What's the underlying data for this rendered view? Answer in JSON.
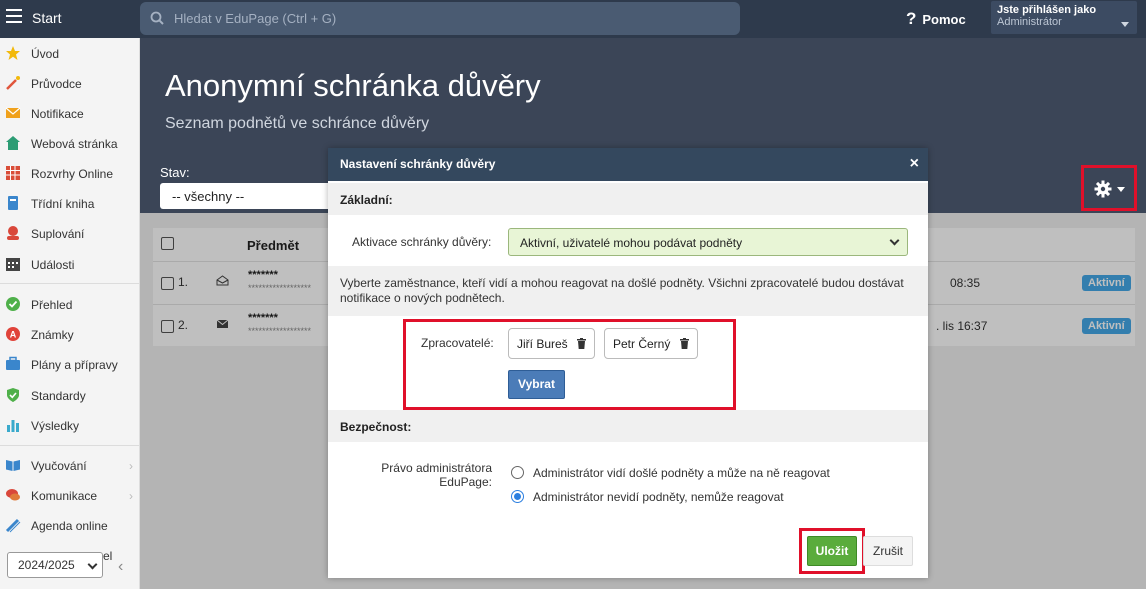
{
  "topbar": {
    "start_label": "Start",
    "search_placeholder": "Hledat v EduPage (Ctrl + G)",
    "help_label": "Pomoc",
    "user_line1": "Jste přihlášen jako",
    "user_line2": "Administrátor"
  },
  "sidebar": {
    "items": [
      {
        "label": "Úvod",
        "icon": "star-icon",
        "color": "#f2b90c"
      },
      {
        "label": "Průvodce",
        "icon": "wand-icon",
        "color": "#e0553b"
      },
      {
        "label": "Notifikace",
        "icon": "envelope-icon",
        "color": "#f0a11c"
      },
      {
        "label": "Webová stránka",
        "icon": "home-icon",
        "color": "#2c9c74"
      },
      {
        "label": "Rozvrhy Online",
        "icon": "calendar-grid-icon",
        "color": "#d94d38"
      },
      {
        "label": "Třídní kniha",
        "icon": "book-icon",
        "color": "#3a86cc"
      },
      {
        "label": "Suplování",
        "icon": "person-icon",
        "color": "#d9473a"
      },
      {
        "label": "Události",
        "icon": "calendar-icon",
        "color": "#444444"
      },
      {
        "label": "Přehled",
        "icon": "check-circle-icon",
        "color": "#4fb04a"
      },
      {
        "label": "Známky",
        "icon": "grade-icon",
        "color": "#e0433a"
      },
      {
        "label": "Plány a přípravy",
        "icon": "briefcase-icon",
        "color": "#3a86cc"
      },
      {
        "label": "Standardy",
        "icon": "shield-check-icon",
        "color": "#4fb04a"
      },
      {
        "label": "Výsledky",
        "icon": "bar-chart-icon",
        "color": "#3aaacc"
      },
      {
        "label": "Vyučování",
        "icon": "open-book-icon",
        "color": "#3a86cc"
      },
      {
        "label": "Komunikace",
        "icon": "chat-icon",
        "color": "#d9473a"
      },
      {
        "label": "Agenda online",
        "icon": "pencil-icon",
        "color": "#3a86cc"
      }
    ],
    "partial_item": "el",
    "year_select": "2024/2025"
  },
  "header": {
    "title": "Anonymní schránka důvěry",
    "subtitle": "Seznam podnětů ve schránce důvěry",
    "stav_label": "Stav:",
    "stav_value": "-- všechny --"
  },
  "table": {
    "header_subject": "Předmět",
    "rows": [
      {
        "num": "1.",
        "subject": "*******",
        "preview": "******************",
        "time": "08:35",
        "status": "Aktivní",
        "icon": "envelope-open-icon"
      },
      {
        "num": "2.",
        "subject": "*******",
        "preview": "******************",
        "time": ". lis 16:37",
        "status": "Aktivní",
        "icon": "envelope-icon"
      }
    ]
  },
  "modal": {
    "title": "Nastavení schránky důvěry",
    "close": "×",
    "section_basic": "Základní:",
    "activation_label": "Aktivace schránky důvěry:",
    "activation_value": "Aktivní, uživatelé mohou podávat podněty",
    "info_text": "Vyberte zaměstnance, kteří vidí a mohou reagovat na došlé podněty. Všichni zpracovatelé budou dostávat notifikace o nových podnětech.",
    "processors_label": "Zpracovatelé:",
    "processors": [
      "Jiří Bureš",
      "Petr Černý"
    ],
    "select_button": "Vybrat",
    "section_security": "Bezpečnost:",
    "admin_right_label": "Právo administrátora EduPage:",
    "admin_options": [
      {
        "label": "Administrátor vidí došlé podněty a může na ně reagovat",
        "checked": false
      },
      {
        "label": "Administrátor nevidí podněty, nemůže reagovat",
        "checked": true
      }
    ],
    "save_button": "Uložit",
    "cancel_button": "Zrušit"
  },
  "colors": {
    "topbar": "#2e3a4c",
    "header": "#3b4557",
    "modal_header": "#34485e",
    "highlight": "#e0102a",
    "save": "#5aac3c",
    "select_button": "#4b7cb8",
    "badge": "#45a9e8"
  }
}
